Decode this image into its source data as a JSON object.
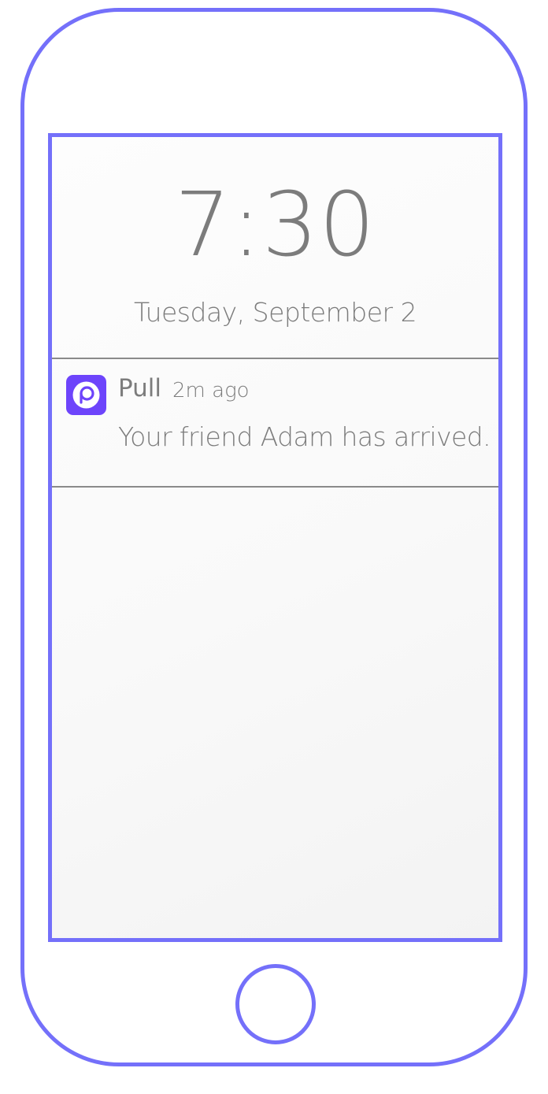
{
  "lock_screen": {
    "time": "7:30",
    "date": "Tuesday, September 2"
  },
  "notification": {
    "app_icon": "pull-app-icon",
    "app_name": "Pull",
    "time_ago": "2m ago",
    "message": "Your friend Adam has arrived."
  },
  "colors": {
    "device_outline": "#7470fa",
    "app_icon_bg": "#6d44fb",
    "text": "#7c7c7c",
    "divider": "#8a8a8a"
  }
}
